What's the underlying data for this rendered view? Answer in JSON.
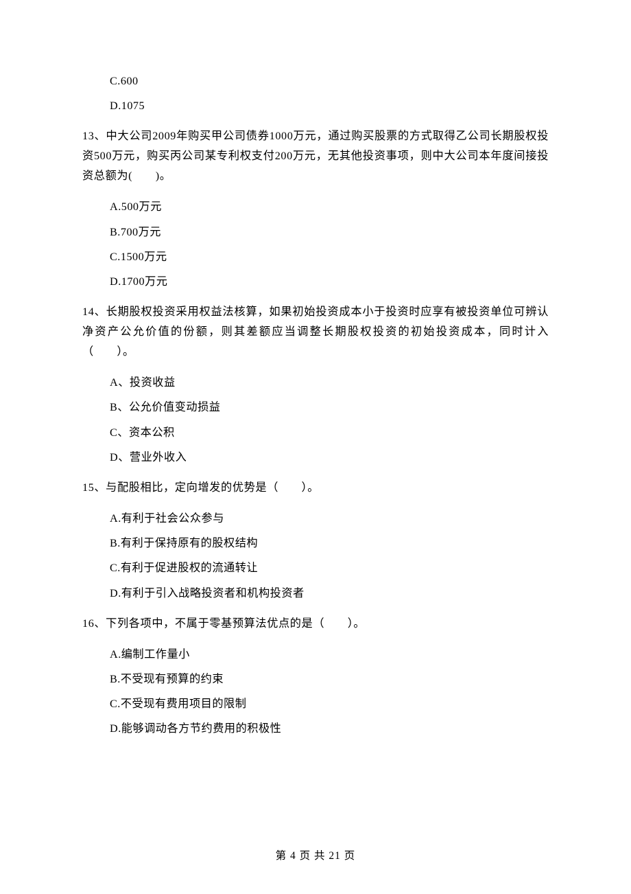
{
  "prev_options": {
    "c": "C.600",
    "d": "D.1075"
  },
  "q13": {
    "stem": "13、中大公司2009年购买甲公司债券1000万元，通过购买股票的方式取得乙公司长期股权投资500万元，购买丙公司某专利权支付200万元，无其他投资事项，则中大公司本年度间接投资总额为(　　)。",
    "a": "A.500万元",
    "b": "B.700万元",
    "c": "C.1500万元",
    "d": "D.1700万元"
  },
  "q14": {
    "stem": "14、长期股权投资采用权益法核算，如果初始投资成本小于投资时应享有被投资单位可辨认净资产公允价值的份额，则其差额应当调整长期股权投资的初始投资成本，同时计入（　　）。",
    "a": "A、投资收益",
    "b": "B、公允价值变动损益",
    "c": "C、资本公积",
    "d": "D、营业外收入"
  },
  "q15": {
    "stem": "15、与配股相比，定向增发的优势是（　　）。",
    "a": "A.有利于社会公众参与",
    "b": "B.有利于保持原有的股权结构",
    "c": "C.有利于促进股权的流通转让",
    "d": "D.有利于引入战略投资者和机构投资者"
  },
  "q16": {
    "stem": "16、下列各项中，不属于零基预算法优点的是（　　）。",
    "a": "A.编制工作量小",
    "b": "B.不受现有预算的约束",
    "c": "C.不受现有费用项目的限制",
    "d": "D.能够调动各方节约费用的积极性"
  },
  "footer": "第 4 页 共 21 页"
}
